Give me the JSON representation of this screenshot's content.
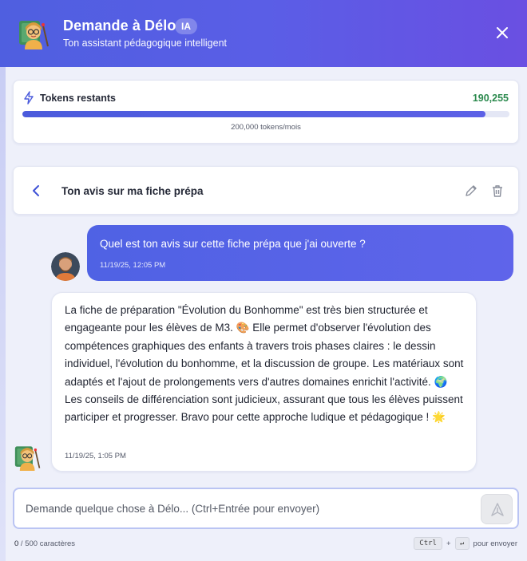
{
  "header": {
    "title": "Demande à Délo",
    "badge": "IA",
    "subtitle": "Ton assistant pédagogique intelligent",
    "close_icon": "close-icon",
    "gradient_start": "#4f5fe0",
    "gradient_end": "#6a4fe2"
  },
  "tokens": {
    "label": "Tokens restants",
    "remaining": "190,255",
    "remaining_fraction": 0.951,
    "subtitle": "200,000 tokens/mois",
    "icon": "lightning-icon",
    "value_color": "#2c8a4e"
  },
  "conversation": {
    "title": "Ton avis sur ma fiche prépa",
    "back_icon": "chevron-left-icon",
    "edit_icon": "pencil-icon",
    "delete_icon": "trash-icon"
  },
  "messages": [
    {
      "role": "user",
      "text": "Quel est ton avis sur cette fiche prépa que j'ai ouverte ?",
      "time": "11/19/25, 12:05 PM"
    },
    {
      "role": "assistant",
      "text": "La fiche de préparation \"Évolution du Bonhomme\" est très bien structurée et engageante pour les élèves de M3. 🎨 Elle permet d'observer l'évolution des compétences graphiques des enfants à travers trois phases claires : le dessin individuel, l'évolution du bonhomme, et la discussion de groupe. Les matériaux sont adaptés et l'ajout de prolongements vers d'autres domaines enrichit l'activité. 🌍 Les conseils de différenciation sont judicieux, assurant que tous les élèves puissent participer et progresser. Bravo pour cette approche ludique et pédagogique ! 🌟",
      "time": "11/19/25, 1:05 PM"
    }
  ],
  "composer": {
    "placeholder": "Demande quelque chose à Délo... (Ctrl+Entrée pour envoyer)",
    "value": "",
    "send_icon": "send-icon"
  },
  "footer": {
    "count": "0",
    "limit": " / 500 caractères",
    "key1": "Ctrl",
    "plus": "+",
    "key2": "↵",
    "hint": "pour envoyer"
  }
}
